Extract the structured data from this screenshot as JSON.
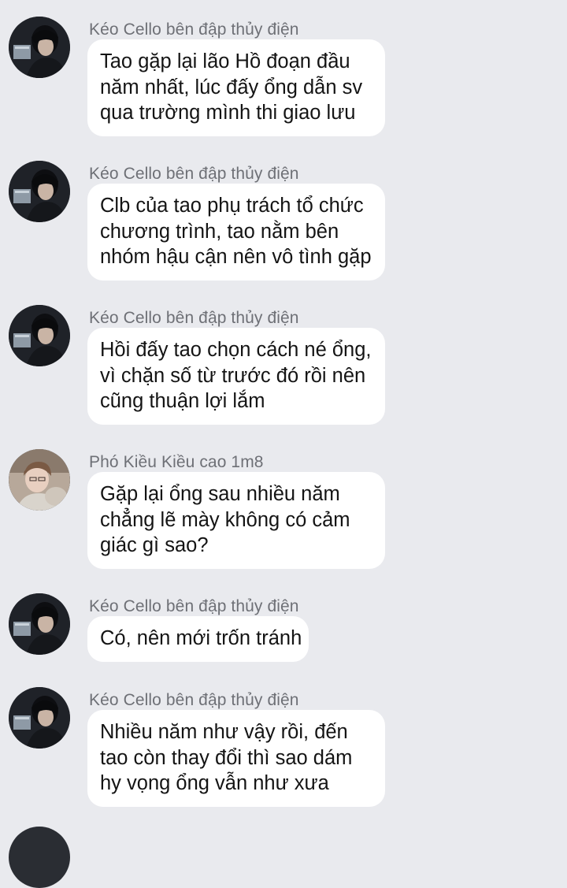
{
  "messages": [
    {
      "sender": "Kéo Cello bên đập thủy điện",
      "avatar": "dark-profile-avatar",
      "lines": [
        "Tao gặp lại lão Hồ đoạn đầu",
        "năm nhất, lúc đấy ổng dẫn sv",
        "qua trường mình thi giao lưu"
      ]
    },
    {
      "sender": "Kéo Cello bên đập thủy điện",
      "avatar": "dark-profile-avatar",
      "lines": [
        "Clb của tao phụ trách tổ chức",
        "chương trình, tao nằm bên",
        "nhóm hậu cận nên vô tình gặp"
      ]
    },
    {
      "sender": "Kéo Cello bên đập thủy điện",
      "avatar": "dark-profile-avatar",
      "lines": [
        "Hồi đấy tao chọn cách né ổng,",
        "vì chặn số từ trước đó rồi nên",
        "cũng thuận lợi lắm"
      ]
    },
    {
      "sender": "Phó Kiều Kiều cao 1m8",
      "avatar": "light-profile-avatar",
      "lines": [
        "Gặp lại ổng sau nhiều năm",
        "chẳng lẽ mày không có cảm",
        "giác gì sao?"
      ]
    },
    {
      "sender": "Kéo Cello bên đập thủy điện",
      "avatar": "dark-profile-avatar",
      "lines": [
        "Có, nên mới trốn tránh"
      ]
    },
    {
      "sender": "Kéo Cello bên đập thủy điện",
      "avatar": "dark-profile-avatar",
      "lines": [
        "Nhiều năm như vậy rồi, đến",
        "tao còn thay đổi thì sao dám",
        "hy vọng ổng vẫn như xưa"
      ]
    }
  ]
}
